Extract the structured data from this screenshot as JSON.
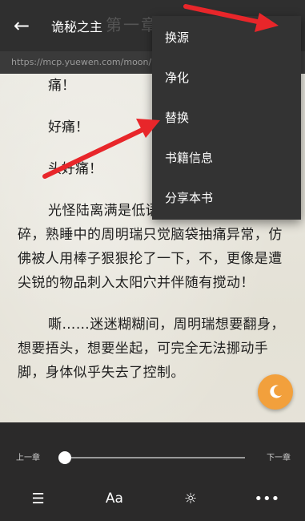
{
  "topbar": {
    "back_icon": "arrow-left-icon",
    "title": "诡秘之主",
    "chapter_hint": "第一章",
    "download_icon": "download-icon",
    "more_icon": "kebab-menu-icon"
  },
  "urlbar": {
    "url": "https://mcp.yuewen.com/moon/read.html?cbid=108645..."
  },
  "reader": {
    "lines": [
      "痛！",
      "好痛！",
      "头好痛！",
      "光怪陆离满是低语的梦境迅速支离破碎，熟睡中的周明瑞只觉脑袋抽痛异常，仿佛被人用棒子狠狠抡了一下，不，更像是遭尖锐的物品刺入太阳穴并伴随有搅动！",
      "嘶……迷迷糊糊间，周明瑞想要翻身，想要捂头，想要坐起，可完全无法挪动手脚，身体似乎失去了控制。"
    ]
  },
  "menu": {
    "items": [
      "换源",
      "净化",
      "替换",
      "书籍信息",
      "分享本书"
    ]
  },
  "fab": {
    "icon": "moon-icon"
  },
  "bottom": {
    "prev_chapter": "上一章",
    "next_chapter": "下一章",
    "progress": 0.0,
    "tools": [
      {
        "name": "list-icon",
        "glyph": "☰"
      },
      {
        "name": "font-icon",
        "glyph": "Aa"
      },
      {
        "name": "brightness-icon",
        "glyph": "☼"
      },
      {
        "name": "more-icon",
        "glyph": "•••"
      }
    ]
  },
  "colors": {
    "topbar": "#2f2f2f",
    "menu": "#333333",
    "fab": "#f2a03c",
    "arrow": "#e8262a"
  }
}
